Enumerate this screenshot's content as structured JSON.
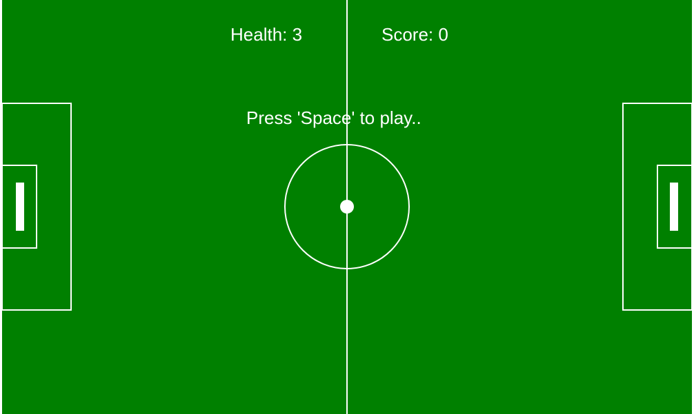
{
  "hud": {
    "health_label": "Health: 3",
    "score_label": "Score: 0"
  },
  "game": {
    "prompt": "Press 'Space' to play.."
  },
  "colors": {
    "pitch": "#008000",
    "lines": "#ffffff"
  }
}
